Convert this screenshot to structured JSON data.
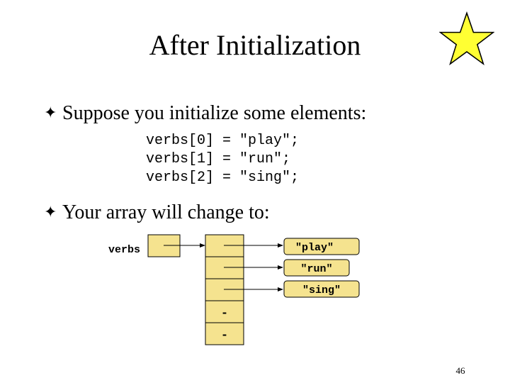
{
  "slide": {
    "title": "After Initialization",
    "bullets": [
      "Suppose you initialize some elements:",
      "Your array will change to:"
    ],
    "bullet_symbol": "✦",
    "code_lines": [
      "verbs[0] = \"play\";",
      "verbs[1] = \"run\";",
      "verbs[2] = \"sing\";"
    ],
    "page_number": "46"
  },
  "diagram": {
    "variable_label": "verbs",
    "cells": [
      {
        "content": "pointer",
        "target": "\"play\""
      },
      {
        "content": "pointer",
        "target": "\"run\""
      },
      {
        "content": "pointer",
        "target": "\"sing\""
      },
      {
        "content": "-",
        "target": null
      },
      {
        "content": "-",
        "target": null
      }
    ],
    "strings": [
      "\"play\"",
      "\"run\"",
      "\"sing\""
    ],
    "null_marker": "-"
  },
  "colors": {
    "cell_fill": "#f5e38f",
    "border": "#000000",
    "star_fill": "#ffff33"
  }
}
